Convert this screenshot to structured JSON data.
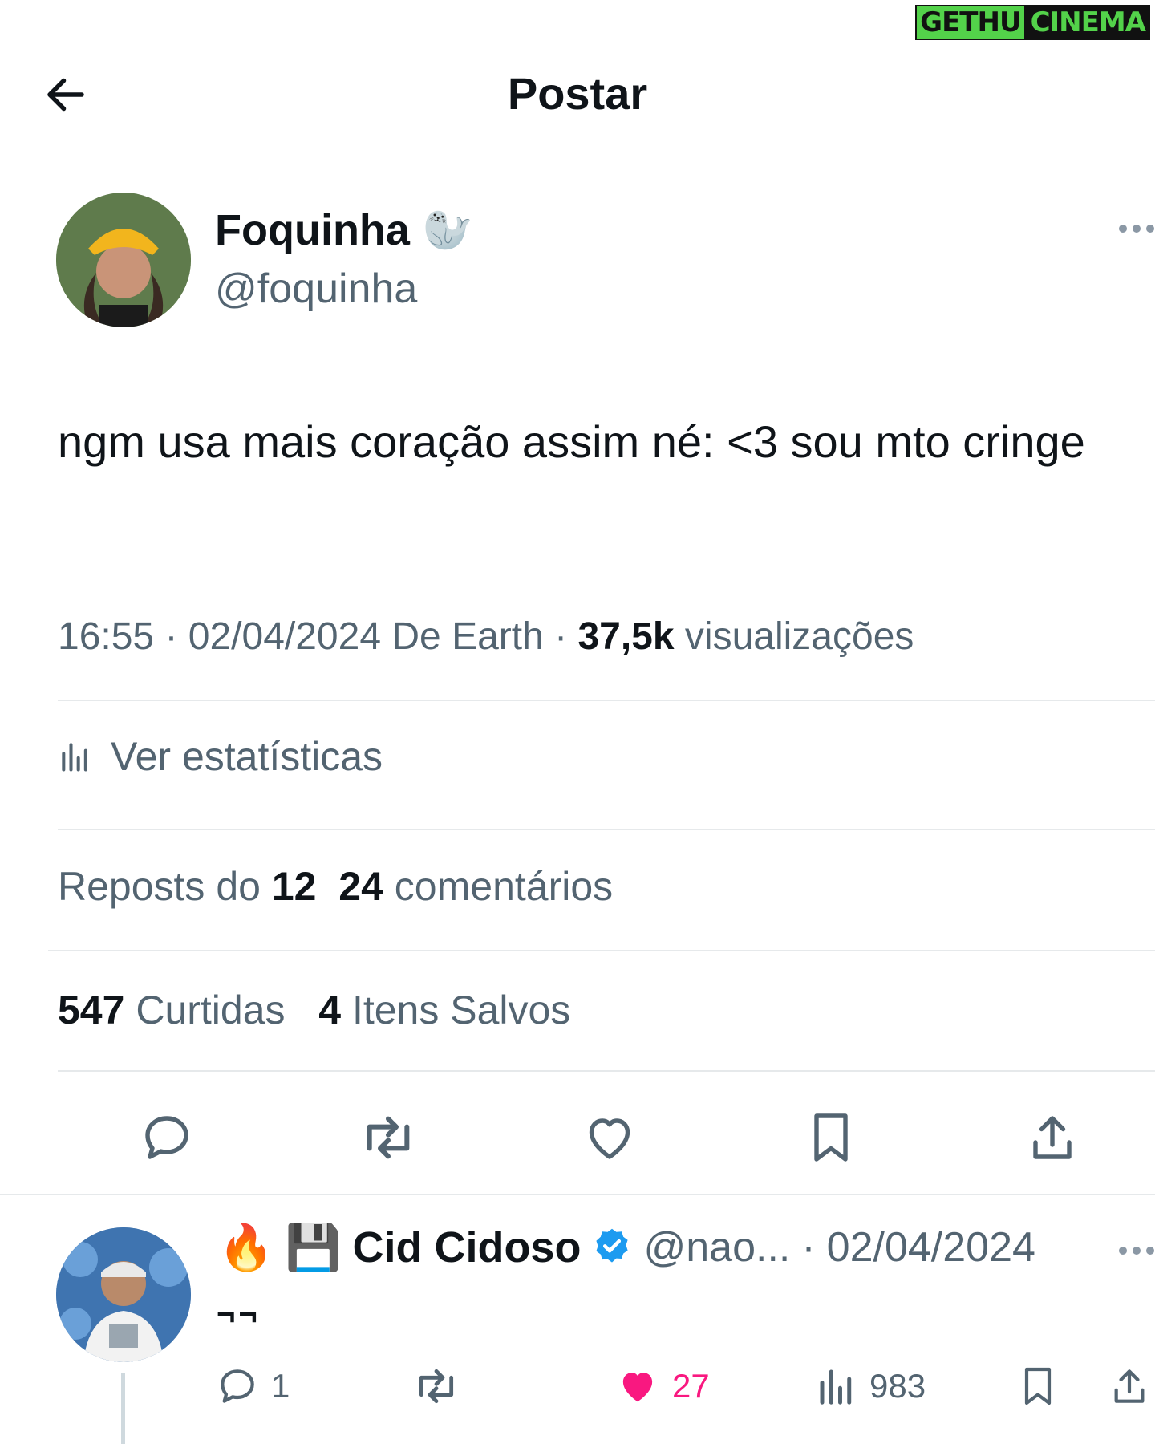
{
  "watermark": {
    "part1": "GETHU",
    "part2": "CINEMA"
  },
  "header": {
    "title": "Postar"
  },
  "post": {
    "author_name": "Foquinha",
    "author_emoji": "🦭",
    "author_handle": "@foquinha",
    "text": "ngm usa mais coração assim né: <3 sou mto cringe",
    "time": "16:55",
    "date": "02/04/2024",
    "location_prefix": "De",
    "location": "Earth",
    "views_count": "37,5k",
    "views_label": "visualizações",
    "stats_label": "Ver estatísticas",
    "reposts_label": "Reposts do",
    "reposts_count": "12",
    "comments_count": "24",
    "comments_label": "comentários",
    "likes_count": "547",
    "likes_label": "Curtidas",
    "saves_count": "4",
    "saves_label": "Itens Salvos"
  },
  "reply": {
    "emoji1": "🔥",
    "emoji2": "💾",
    "author_name": "Cid Cidoso",
    "verified": true,
    "author_handle": "@nao...",
    "date": "02/04/2024",
    "text": "¬¬",
    "replies": "1",
    "likes": "27",
    "views": "983"
  },
  "colors": {
    "like": "#f91880",
    "verified": "#1d9bf0",
    "muted": "#536471"
  }
}
